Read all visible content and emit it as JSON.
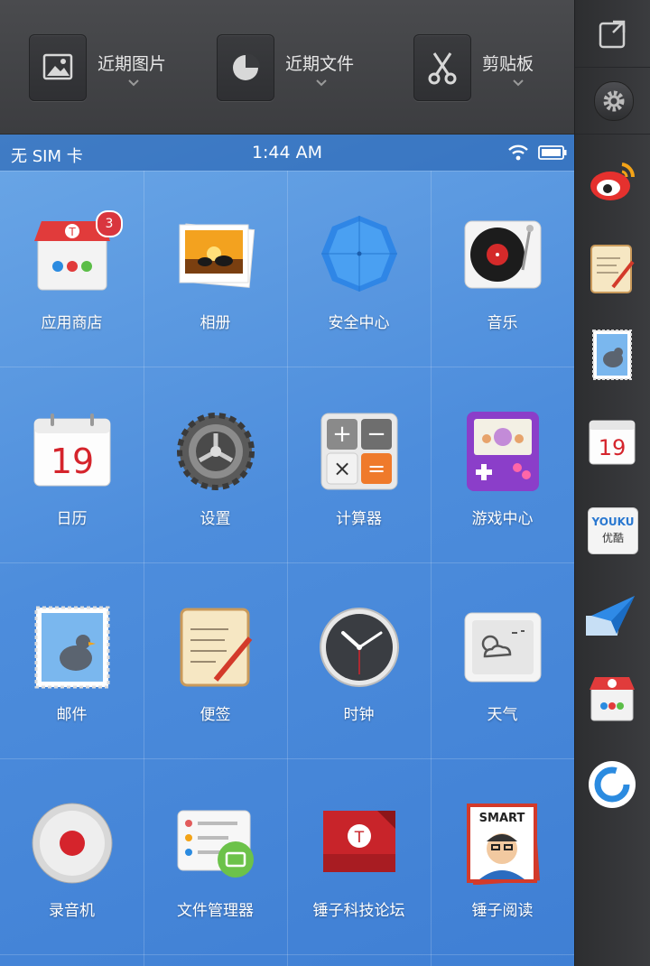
{
  "toolbar": {
    "recent_images": "近期图片",
    "recent_files": "近期文件",
    "clipboard": "剪贴板"
  },
  "status": {
    "carrier": "无 SIM 卡",
    "time": "1:44 AM"
  },
  "apps": [
    {
      "label": "应用商店",
      "icon": "app-store-icon",
      "badge": "3"
    },
    {
      "label": "相册",
      "icon": "photos-icon"
    },
    {
      "label": "安全中心",
      "icon": "security-umbrella-icon"
    },
    {
      "label": "音乐",
      "icon": "music-turntable-icon"
    },
    {
      "label": "日历",
      "icon": "calendar-icon",
      "day": "19"
    },
    {
      "label": "设置",
      "icon": "settings-gear-icon"
    },
    {
      "label": "计算器",
      "icon": "calculator-icon"
    },
    {
      "label": "游戏中心",
      "icon": "game-center-icon"
    },
    {
      "label": "邮件",
      "icon": "mail-stamp-icon"
    },
    {
      "label": "便签",
      "icon": "notes-icon"
    },
    {
      "label": "时钟",
      "icon": "clock-icon"
    },
    {
      "label": "天气",
      "icon": "weather-icon"
    },
    {
      "label": "录音机",
      "icon": "recorder-icon"
    },
    {
      "label": "文件管理器",
      "icon": "file-manager-icon"
    },
    {
      "label": "锤子科技论坛",
      "icon": "forum-icon"
    },
    {
      "label": "锤子阅读",
      "icon": "smart-reader-icon",
      "cover_text": "SMART"
    }
  ],
  "dock": {
    "calendar_day": "19",
    "youku_text": "YOUKU",
    "youku_cn": "优酷"
  },
  "colors": {
    "screen_blue": "#4d8ddc",
    "badge_red": "#d9363e"
  }
}
